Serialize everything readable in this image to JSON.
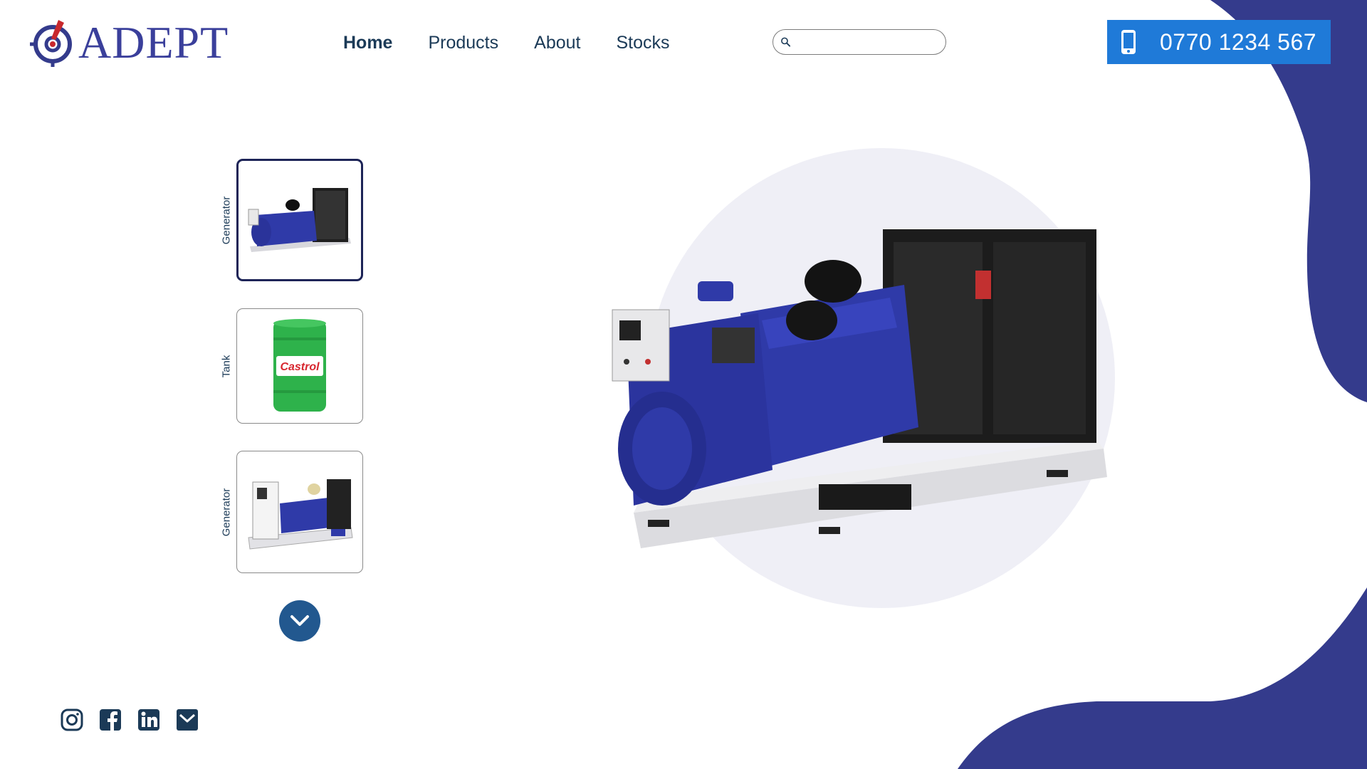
{
  "brand": {
    "name": "ADEPT"
  },
  "nav": {
    "items": [
      {
        "label": "Home",
        "active": true
      },
      {
        "label": "Products",
        "active": false
      },
      {
        "label": "About",
        "active": false
      },
      {
        "label": "Stocks",
        "active": false
      }
    ]
  },
  "search": {
    "value": "",
    "placeholder": ""
  },
  "contact": {
    "phone": "0770 1234 567"
  },
  "gallery": {
    "thumbnails": [
      {
        "label": "Generator",
        "selected": true,
        "image": "generator-blue"
      },
      {
        "label": "Tank",
        "selected": false,
        "image": "castrol-drum"
      },
      {
        "label": "Generator",
        "selected": false,
        "image": "generator-white"
      }
    ],
    "hero_image": "generator-blue-large"
  },
  "social": {
    "icons": [
      "instagram-icon",
      "facebook-icon",
      "linkedin-icon",
      "mail-icon"
    ]
  },
  "colors": {
    "brand_navy": "#343b8c",
    "brand_red": "#c8282d",
    "phone_blue": "#1f7ad8",
    "text_dark": "#1b3a57",
    "button_blue": "#22588f"
  }
}
